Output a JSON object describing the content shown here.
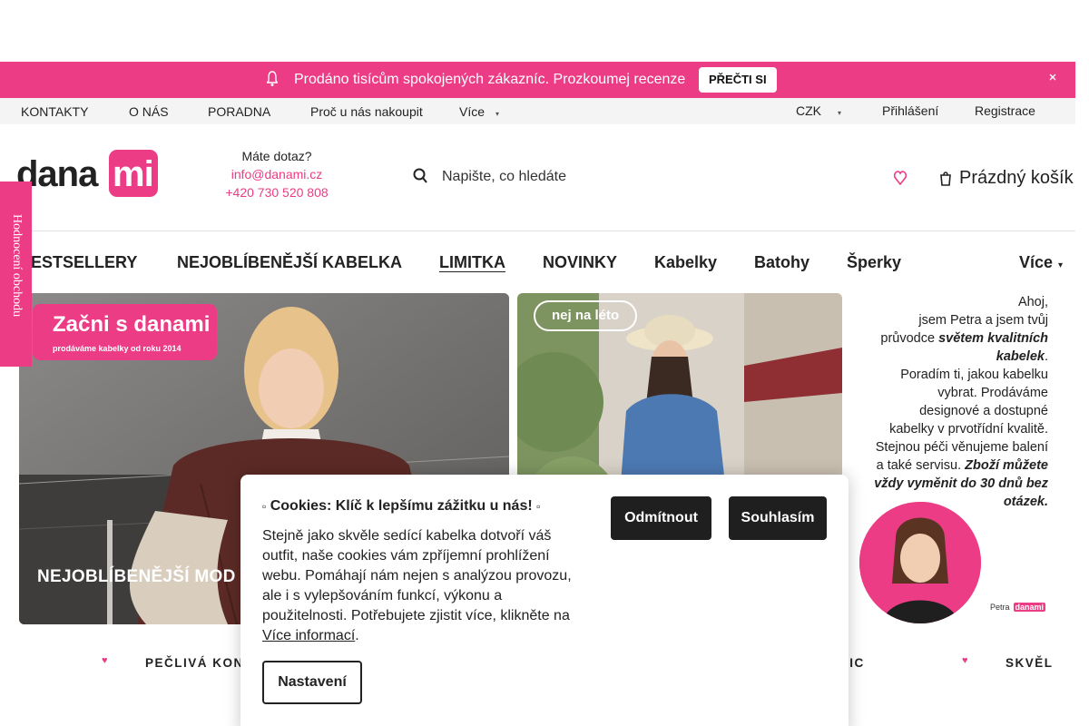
{
  "announcement": {
    "message": "Prodáno tisícům spokojených zákazníc. Prozkoumej recenze",
    "cta_label": "PŘEČTI SI"
  },
  "top_links": {
    "items": [
      "KONTAKTY",
      "O NÁS",
      "PORADNA",
      "Proč u nás nakoupit",
      "Více"
    ],
    "currency": "CZK",
    "login": "Přihlášení",
    "register": "Registrace"
  },
  "header": {
    "logo": {
      "part1": "dana",
      "part2": "mi"
    },
    "contact_question": "Máte dotaz?",
    "email": "info@danami.cz",
    "phone": "+420 730 520 808",
    "search_placeholder": "Napište, co hledáte",
    "cart_label": "Prázdný košík"
  },
  "main_nav": {
    "items": [
      "BESTSELLERY",
      "NEJOBLÍBENĚJŠÍ KABELKA",
      "LIMITKA",
      "NOVINKY",
      "Kabelky",
      "Batohy",
      "Šperky"
    ],
    "active_index": 2,
    "more_label": "Více"
  },
  "side_tab": {
    "label": "Hodnocení obchodu"
  },
  "banners": {
    "b1_title": "Začni s danami",
    "b1_subtitle": "prodáváme kabelky od roku 2014",
    "b1_caption": "NEJOBLÍBENĚJŠÍ MOD",
    "b2_pill": "nej na léto",
    "b3_line1": "Ahoj,",
    "b3_line2": "jsem Petra a jsem tvůj",
    "b3_line3a": "průvodce ",
    "b3_line3b": "světem kvalitních",
    "b3_line4": "kabelek",
    "b3_line5": "Poradím ti, jakou kabelku",
    "b3_line6": "vybrat. Prodáváme",
    "b3_line7": "designové a dostupné",
    "b3_line8": "kabelky v prvotřídní kvalitě.",
    "b3_line9": "Stejnou péči věnujeme balení",
    "b3_line10": "a také servisu.",
    "b3_line10b": " Zboží můžete",
    "b3_line11": "vždy vyměnit do 30 dnů bez",
    "b3_line12": "otázek.",
    "b3_signature": "Petra",
    "b3_signature_logo": "danami"
  },
  "ticker": {
    "items": [
      "PEČLIVÁ KON",
      "NIC",
      "SKVĚL"
    ]
  },
  "cookie": {
    "title": "Cookies: Klíč k lepšímu zážitku u nás!",
    "body": "Stejně jako skvěle sedící kabelka dotvoří váš outfit, naše cookies vám zpříjemní prohlížení webu. Pomáhají nám nejen s analýzou provozu, ale i s vylepšováním funkcí, výkonu a použitelnosti. Potřebujete zjistit více, klikněte na ",
    "more_link": "Více informací",
    "body_end": ".",
    "reject_label": "Odmítnout",
    "accept_label": "Souhlasím",
    "settings_label": "Nastavení"
  },
  "colors": {
    "brand_pink": "#ec3c85",
    "dark_button": "#1f1f1f",
    "link_pink": "#ec3c85"
  },
  "icons": {
    "announcement": "bell-icon",
    "close": "close-icon",
    "currency_chevron": "chevron-down-icon",
    "search": "search-icon",
    "wishlist": "heart-icon",
    "cart": "cart-icon",
    "ticker": "heart-icon"
  }
}
